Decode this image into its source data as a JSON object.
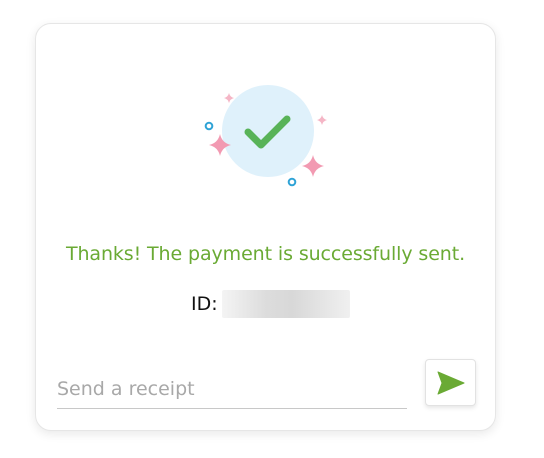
{
  "card": {
    "message": "Thanks! The payment is successfully sent.",
    "id_label": "ID:",
    "id_value": ""
  },
  "receipt": {
    "placeholder": "Send a receipt",
    "value": ""
  },
  "icons": {
    "success": "check-circle-icon",
    "sparkle": "sparkle-icon",
    "dot": "dot-ring-icon",
    "send": "send-icon"
  },
  "colors": {
    "accent": "#6aaa34",
    "check": "#58b358",
    "circle": "#dff1fb",
    "sparkle_pink": "#f29ab2",
    "dot_blue": "#2fa3d6"
  }
}
